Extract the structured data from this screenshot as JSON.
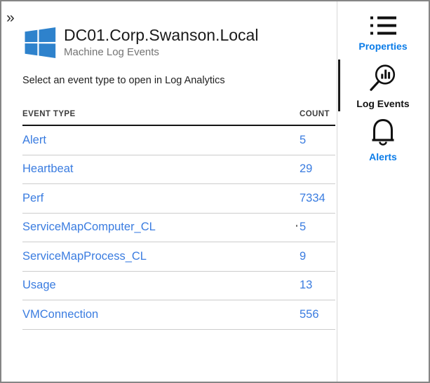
{
  "blade": {
    "collapse_glyph": "»",
    "title": "DC01.Corp.Swanson.Local",
    "subtitle": "Machine Log Events",
    "instruction": "Select an event type to open in Log Analytics"
  },
  "table": {
    "columns": [
      "EVENT TYPE",
      "COUNT"
    ],
    "rows": [
      {
        "event_type": "Alert",
        "count": "5"
      },
      {
        "event_type": "Heartbeat",
        "count": "29"
      },
      {
        "event_type": "Perf",
        "count": "7334"
      },
      {
        "event_type": "ServiceMapComputer_CL",
        "count": "5"
      },
      {
        "event_type": "ServiceMapProcess_CL",
        "count": "9"
      },
      {
        "event_type": "Usage",
        "count": "13"
      },
      {
        "event_type": "VMConnection",
        "count": "556"
      }
    ]
  },
  "toolbar": {
    "items": [
      {
        "label": "Properties",
        "icon": "bulleted-list-icon",
        "active": false
      },
      {
        "label": "Log Events",
        "icon": "search-analytics-icon",
        "active": true
      },
      {
        "label": "Alerts",
        "icon": "bell-icon",
        "active": false
      }
    ]
  },
  "colors": {
    "link_blue": "#3a7ce0",
    "toolbar_label_blue": "#0b7ce8",
    "toolbar_active_label": "#111111",
    "windows_logo_blue": "#2e82cc",
    "divider_gray": "#cccccc"
  }
}
